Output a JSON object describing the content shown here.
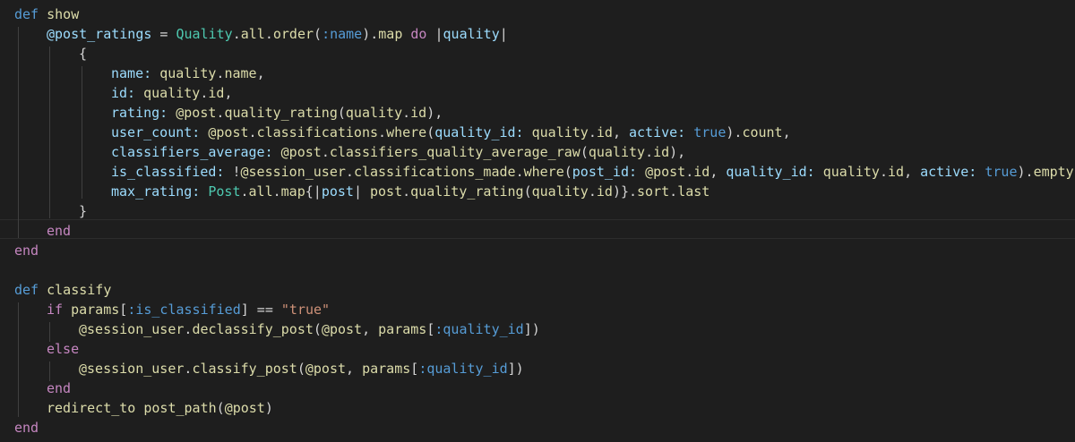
{
  "colors": {
    "background": "#1e1e1e",
    "keyword": "#c586c0",
    "def_keyword": "#569cd6",
    "method": "#dcdcaa",
    "variable": "#9cdcfe",
    "class": "#4ec9b0",
    "string": "#ce9178",
    "constant": "#569cd6",
    "plain": "#d4d4d4"
  },
  "editor": {
    "lines": [
      {
        "indent": 0,
        "tokens": [
          {
            "t": "def",
            "c": "def_keyword"
          },
          {
            "t": " ",
            "c": "plain"
          },
          {
            "t": "show",
            "c": "method"
          }
        ]
      },
      {
        "indent": 1,
        "tokens": [
          {
            "t": "@post_ratings",
            "c": "variable"
          },
          {
            "t": " = ",
            "c": "plain"
          },
          {
            "t": "Quality",
            "c": "class"
          },
          {
            "t": ".",
            "c": "plain"
          },
          {
            "t": "all",
            "c": "method"
          },
          {
            "t": ".",
            "c": "plain"
          },
          {
            "t": "order",
            "c": "method"
          },
          {
            "t": "(",
            "c": "plain"
          },
          {
            "t": ":name",
            "c": "constant"
          },
          {
            "t": ").",
            "c": "plain"
          },
          {
            "t": "map",
            "c": "method"
          },
          {
            "t": " ",
            "c": "plain"
          },
          {
            "t": "do",
            "c": "keyword"
          },
          {
            "t": " |",
            "c": "plain"
          },
          {
            "t": "quality",
            "c": "variable"
          },
          {
            "t": "|",
            "c": "plain"
          }
        ]
      },
      {
        "indent": 2,
        "tokens": [
          {
            "t": "{",
            "c": "plain"
          }
        ]
      },
      {
        "indent": 3,
        "tokens": [
          {
            "t": "name:",
            "c": "variable"
          },
          {
            "t": " ",
            "c": "plain"
          },
          {
            "t": "quality",
            "c": "method"
          },
          {
            "t": ".",
            "c": "plain"
          },
          {
            "t": "name",
            "c": "method"
          },
          {
            "t": ",",
            "c": "plain"
          }
        ]
      },
      {
        "indent": 3,
        "tokens": [
          {
            "t": "id:",
            "c": "variable"
          },
          {
            "t": " ",
            "c": "plain"
          },
          {
            "t": "quality",
            "c": "method"
          },
          {
            "t": ".",
            "c": "plain"
          },
          {
            "t": "id",
            "c": "method"
          },
          {
            "t": ",",
            "c": "plain"
          }
        ]
      },
      {
        "indent": 3,
        "tokens": [
          {
            "t": "rating:",
            "c": "variable"
          },
          {
            "t": " ",
            "c": "plain"
          },
          {
            "t": "@post",
            "c": "method"
          },
          {
            "t": ".",
            "c": "plain"
          },
          {
            "t": "quality_rating",
            "c": "method"
          },
          {
            "t": "(",
            "c": "plain"
          },
          {
            "t": "quality",
            "c": "method"
          },
          {
            "t": ".",
            "c": "plain"
          },
          {
            "t": "id",
            "c": "method"
          },
          {
            "t": "),",
            "c": "plain"
          }
        ]
      },
      {
        "indent": 3,
        "tokens": [
          {
            "t": "user_count:",
            "c": "variable"
          },
          {
            "t": " ",
            "c": "plain"
          },
          {
            "t": "@post",
            "c": "method"
          },
          {
            "t": ".",
            "c": "plain"
          },
          {
            "t": "classifications",
            "c": "method"
          },
          {
            "t": ".",
            "c": "plain"
          },
          {
            "t": "where",
            "c": "method"
          },
          {
            "t": "(",
            "c": "plain"
          },
          {
            "t": "quality_id:",
            "c": "variable"
          },
          {
            "t": " ",
            "c": "plain"
          },
          {
            "t": "quality",
            "c": "method"
          },
          {
            "t": ".",
            "c": "plain"
          },
          {
            "t": "id",
            "c": "method"
          },
          {
            "t": ", ",
            "c": "plain"
          },
          {
            "t": "active:",
            "c": "variable"
          },
          {
            "t": " ",
            "c": "plain"
          },
          {
            "t": "true",
            "c": "constant"
          },
          {
            "t": ").",
            "c": "plain"
          },
          {
            "t": "count",
            "c": "method"
          },
          {
            "t": ",",
            "c": "plain"
          }
        ]
      },
      {
        "indent": 3,
        "tokens": [
          {
            "t": "classifiers_average:",
            "c": "variable"
          },
          {
            "t": " ",
            "c": "plain"
          },
          {
            "t": "@post",
            "c": "method"
          },
          {
            "t": ".",
            "c": "plain"
          },
          {
            "t": "classifiers_quality_average_raw",
            "c": "method"
          },
          {
            "t": "(",
            "c": "plain"
          },
          {
            "t": "quality",
            "c": "method"
          },
          {
            "t": ".",
            "c": "plain"
          },
          {
            "t": "id",
            "c": "method"
          },
          {
            "t": "),",
            "c": "plain"
          }
        ]
      },
      {
        "indent": 3,
        "tokens": [
          {
            "t": "is_classified:",
            "c": "variable"
          },
          {
            "t": " !",
            "c": "plain"
          },
          {
            "t": "@session_user",
            "c": "method"
          },
          {
            "t": ".",
            "c": "plain"
          },
          {
            "t": "classifications_made",
            "c": "method"
          },
          {
            "t": ".",
            "c": "plain"
          },
          {
            "t": "where",
            "c": "method"
          },
          {
            "t": "(",
            "c": "plain"
          },
          {
            "t": "post_id:",
            "c": "variable"
          },
          {
            "t": " ",
            "c": "plain"
          },
          {
            "t": "@post",
            "c": "method"
          },
          {
            "t": ".",
            "c": "plain"
          },
          {
            "t": "id",
            "c": "method"
          },
          {
            "t": ", ",
            "c": "plain"
          },
          {
            "t": "quality_id:",
            "c": "variable"
          },
          {
            "t": " ",
            "c": "plain"
          },
          {
            "t": "quality",
            "c": "method"
          },
          {
            "t": ".",
            "c": "plain"
          },
          {
            "t": "id",
            "c": "method"
          },
          {
            "t": ", ",
            "c": "plain"
          },
          {
            "t": "active:",
            "c": "variable"
          },
          {
            "t": " ",
            "c": "plain"
          },
          {
            "t": "true",
            "c": "constant"
          },
          {
            "t": ").",
            "c": "plain"
          },
          {
            "t": "empty?",
            "c": "method"
          },
          {
            "t": ",",
            "c": "plain"
          }
        ]
      },
      {
        "indent": 3,
        "tokens": [
          {
            "t": "max_rating:",
            "c": "variable"
          },
          {
            "t": " ",
            "c": "plain"
          },
          {
            "t": "Post",
            "c": "class"
          },
          {
            "t": ".",
            "c": "plain"
          },
          {
            "t": "all",
            "c": "method"
          },
          {
            "t": ".",
            "c": "plain"
          },
          {
            "t": "map",
            "c": "method"
          },
          {
            "t": "{|",
            "c": "plain"
          },
          {
            "t": "post",
            "c": "variable"
          },
          {
            "t": "| ",
            "c": "plain"
          },
          {
            "t": "post",
            "c": "method"
          },
          {
            "t": ".",
            "c": "plain"
          },
          {
            "t": "quality_rating",
            "c": "method"
          },
          {
            "t": "(",
            "c": "plain"
          },
          {
            "t": "quality",
            "c": "method"
          },
          {
            "t": ".",
            "c": "plain"
          },
          {
            "t": "id",
            "c": "method"
          },
          {
            "t": ")}.",
            "c": "plain"
          },
          {
            "t": "sort",
            "c": "method"
          },
          {
            "t": ".",
            "c": "plain"
          },
          {
            "t": "last",
            "c": "method"
          }
        ]
      },
      {
        "indent": 2,
        "tokens": [
          {
            "t": "}",
            "c": "plain"
          }
        ]
      },
      {
        "indent": 1,
        "tokens": [
          {
            "t": "end",
            "c": "keyword"
          }
        ]
      },
      {
        "indent": 0,
        "tokens": [
          {
            "t": "end",
            "c": "keyword"
          }
        ]
      },
      {
        "indent": 0,
        "tokens": []
      },
      {
        "indent": 0,
        "tokens": [
          {
            "t": "def",
            "c": "def_keyword"
          },
          {
            "t": " ",
            "c": "plain"
          },
          {
            "t": "classify",
            "c": "method"
          }
        ]
      },
      {
        "indent": 1,
        "tokens": [
          {
            "t": "if",
            "c": "keyword"
          },
          {
            "t": " ",
            "c": "plain"
          },
          {
            "t": "params",
            "c": "method"
          },
          {
            "t": "[",
            "c": "plain"
          },
          {
            "t": ":is_classified",
            "c": "constant"
          },
          {
            "t": "] == ",
            "c": "plain"
          },
          {
            "t": "\"true\"",
            "c": "string"
          }
        ]
      },
      {
        "indent": 2,
        "tokens": [
          {
            "t": "@session_user",
            "c": "method"
          },
          {
            "t": ".",
            "c": "plain"
          },
          {
            "t": "declassify_post",
            "c": "method"
          },
          {
            "t": "(",
            "c": "plain"
          },
          {
            "t": "@post",
            "c": "method"
          },
          {
            "t": ", ",
            "c": "plain"
          },
          {
            "t": "params",
            "c": "method"
          },
          {
            "t": "[",
            "c": "plain"
          },
          {
            "t": ":quality_id",
            "c": "constant"
          },
          {
            "t": "])",
            "c": "plain"
          }
        ]
      },
      {
        "indent": 1,
        "tokens": [
          {
            "t": "else",
            "c": "keyword"
          }
        ]
      },
      {
        "indent": 2,
        "tokens": [
          {
            "t": "@session_user",
            "c": "method"
          },
          {
            "t": ".",
            "c": "plain"
          },
          {
            "t": "classify_post",
            "c": "method"
          },
          {
            "t": "(",
            "c": "plain"
          },
          {
            "t": "@post",
            "c": "method"
          },
          {
            "t": ", ",
            "c": "plain"
          },
          {
            "t": "params",
            "c": "method"
          },
          {
            "t": "[",
            "c": "plain"
          },
          {
            "t": ":quality_id",
            "c": "constant"
          },
          {
            "t": "])",
            "c": "plain"
          }
        ]
      },
      {
        "indent": 1,
        "tokens": [
          {
            "t": "end",
            "c": "keyword"
          }
        ]
      },
      {
        "indent": 1,
        "tokens": [
          {
            "t": "redirect_to",
            "c": "method"
          },
          {
            "t": " ",
            "c": "plain"
          },
          {
            "t": "post_path",
            "c": "method"
          },
          {
            "t": "(",
            "c": "plain"
          },
          {
            "t": "@post",
            "c": "method"
          },
          {
            "t": ")",
            "c": "plain"
          }
        ]
      },
      {
        "indent": 0,
        "tokens": [
          {
            "t": "end",
            "c": "keyword"
          }
        ]
      }
    ]
  }
}
